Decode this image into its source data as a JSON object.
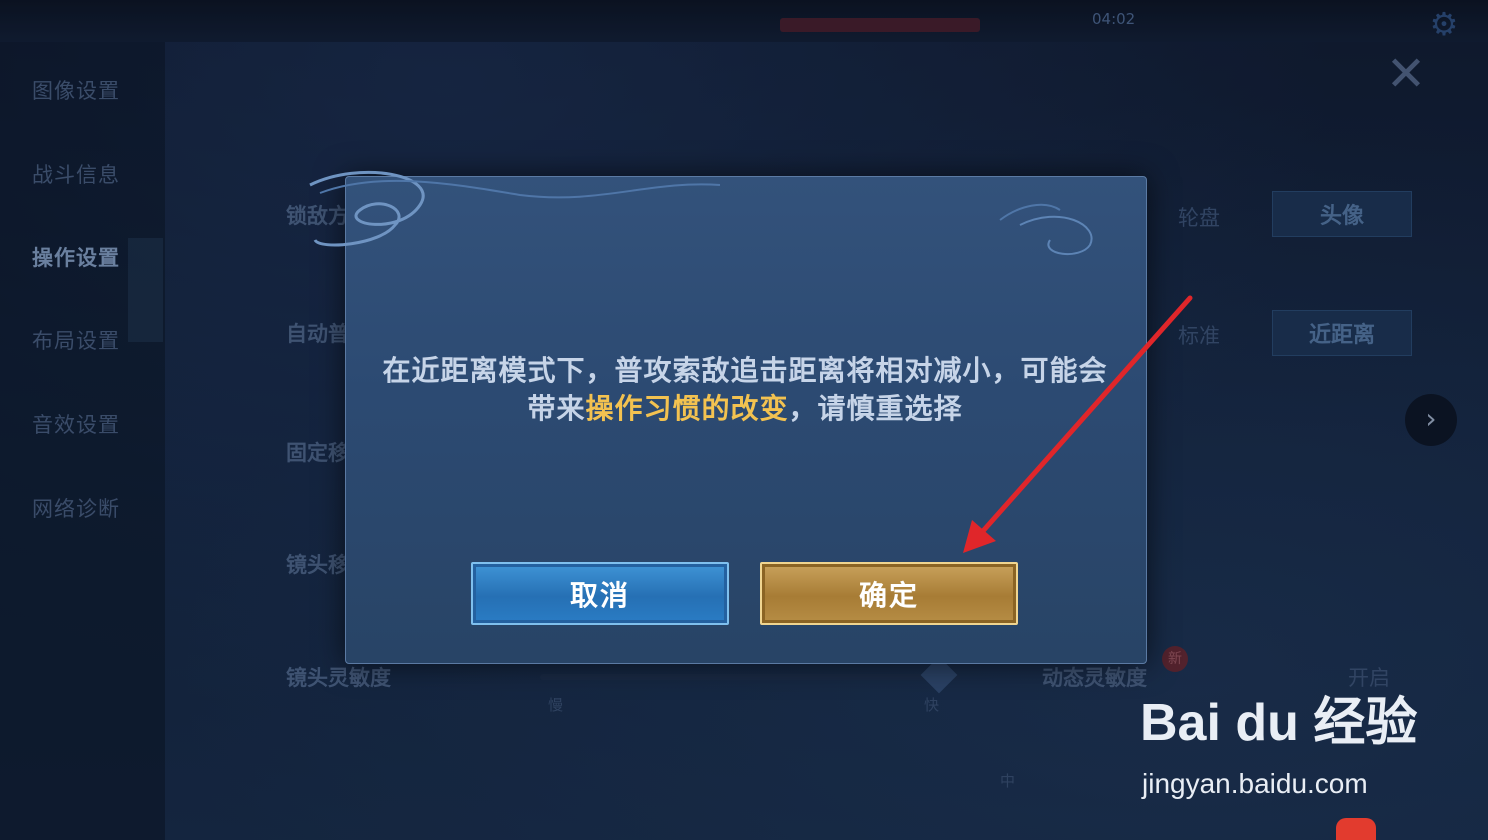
{
  "topbar": {
    "timer": "04:02"
  },
  "sidebar": {
    "items": [
      {
        "label": "图像设置"
      },
      {
        "label": "战斗信息"
      },
      {
        "label": "操作设置",
        "active": true
      },
      {
        "label": "布局设置"
      },
      {
        "label": "音效设置"
      },
      {
        "label": "网络诊断"
      }
    ]
  },
  "settings": {
    "rows": [
      {
        "label": "锁敌方"
      },
      {
        "label": "自动普"
      },
      {
        "label": "固定移"
      },
      {
        "label": "镜头移"
      },
      {
        "label": "镜头灵敏度"
      }
    ],
    "lock_options": {
      "left": "轮盘",
      "right": "头像"
    },
    "distance_options": {
      "left": "标准",
      "right": "近距离"
    },
    "sensitivity": {
      "slow": "慢",
      "fast": "快",
      "value_fraction": 0.95
    },
    "dynamic_label": "动态灵敏度",
    "dynamic_value": "开启",
    "new_badge": "新",
    "bottom_tick": "中"
  },
  "dialog": {
    "message_part1": "在近距离模式下，普攻索敌追击距离将相对减小，可能会带来",
    "message_highlight": "操作习惯的改变",
    "message_part2": "，请慎重选择",
    "cancel_label": "取消",
    "confirm_label": "确定"
  },
  "icons": {
    "close": "close-icon",
    "next": "chevron-right-icon",
    "gear": "gear-icon"
  },
  "watermark": {
    "logo_text": "Bai du 经验",
    "url": "jingyan.baidu.com"
  },
  "colors": {
    "highlight": "#f3c250",
    "cancel": "#2670b4",
    "confirm": "#a77c35",
    "arrow": "#e0262a"
  }
}
